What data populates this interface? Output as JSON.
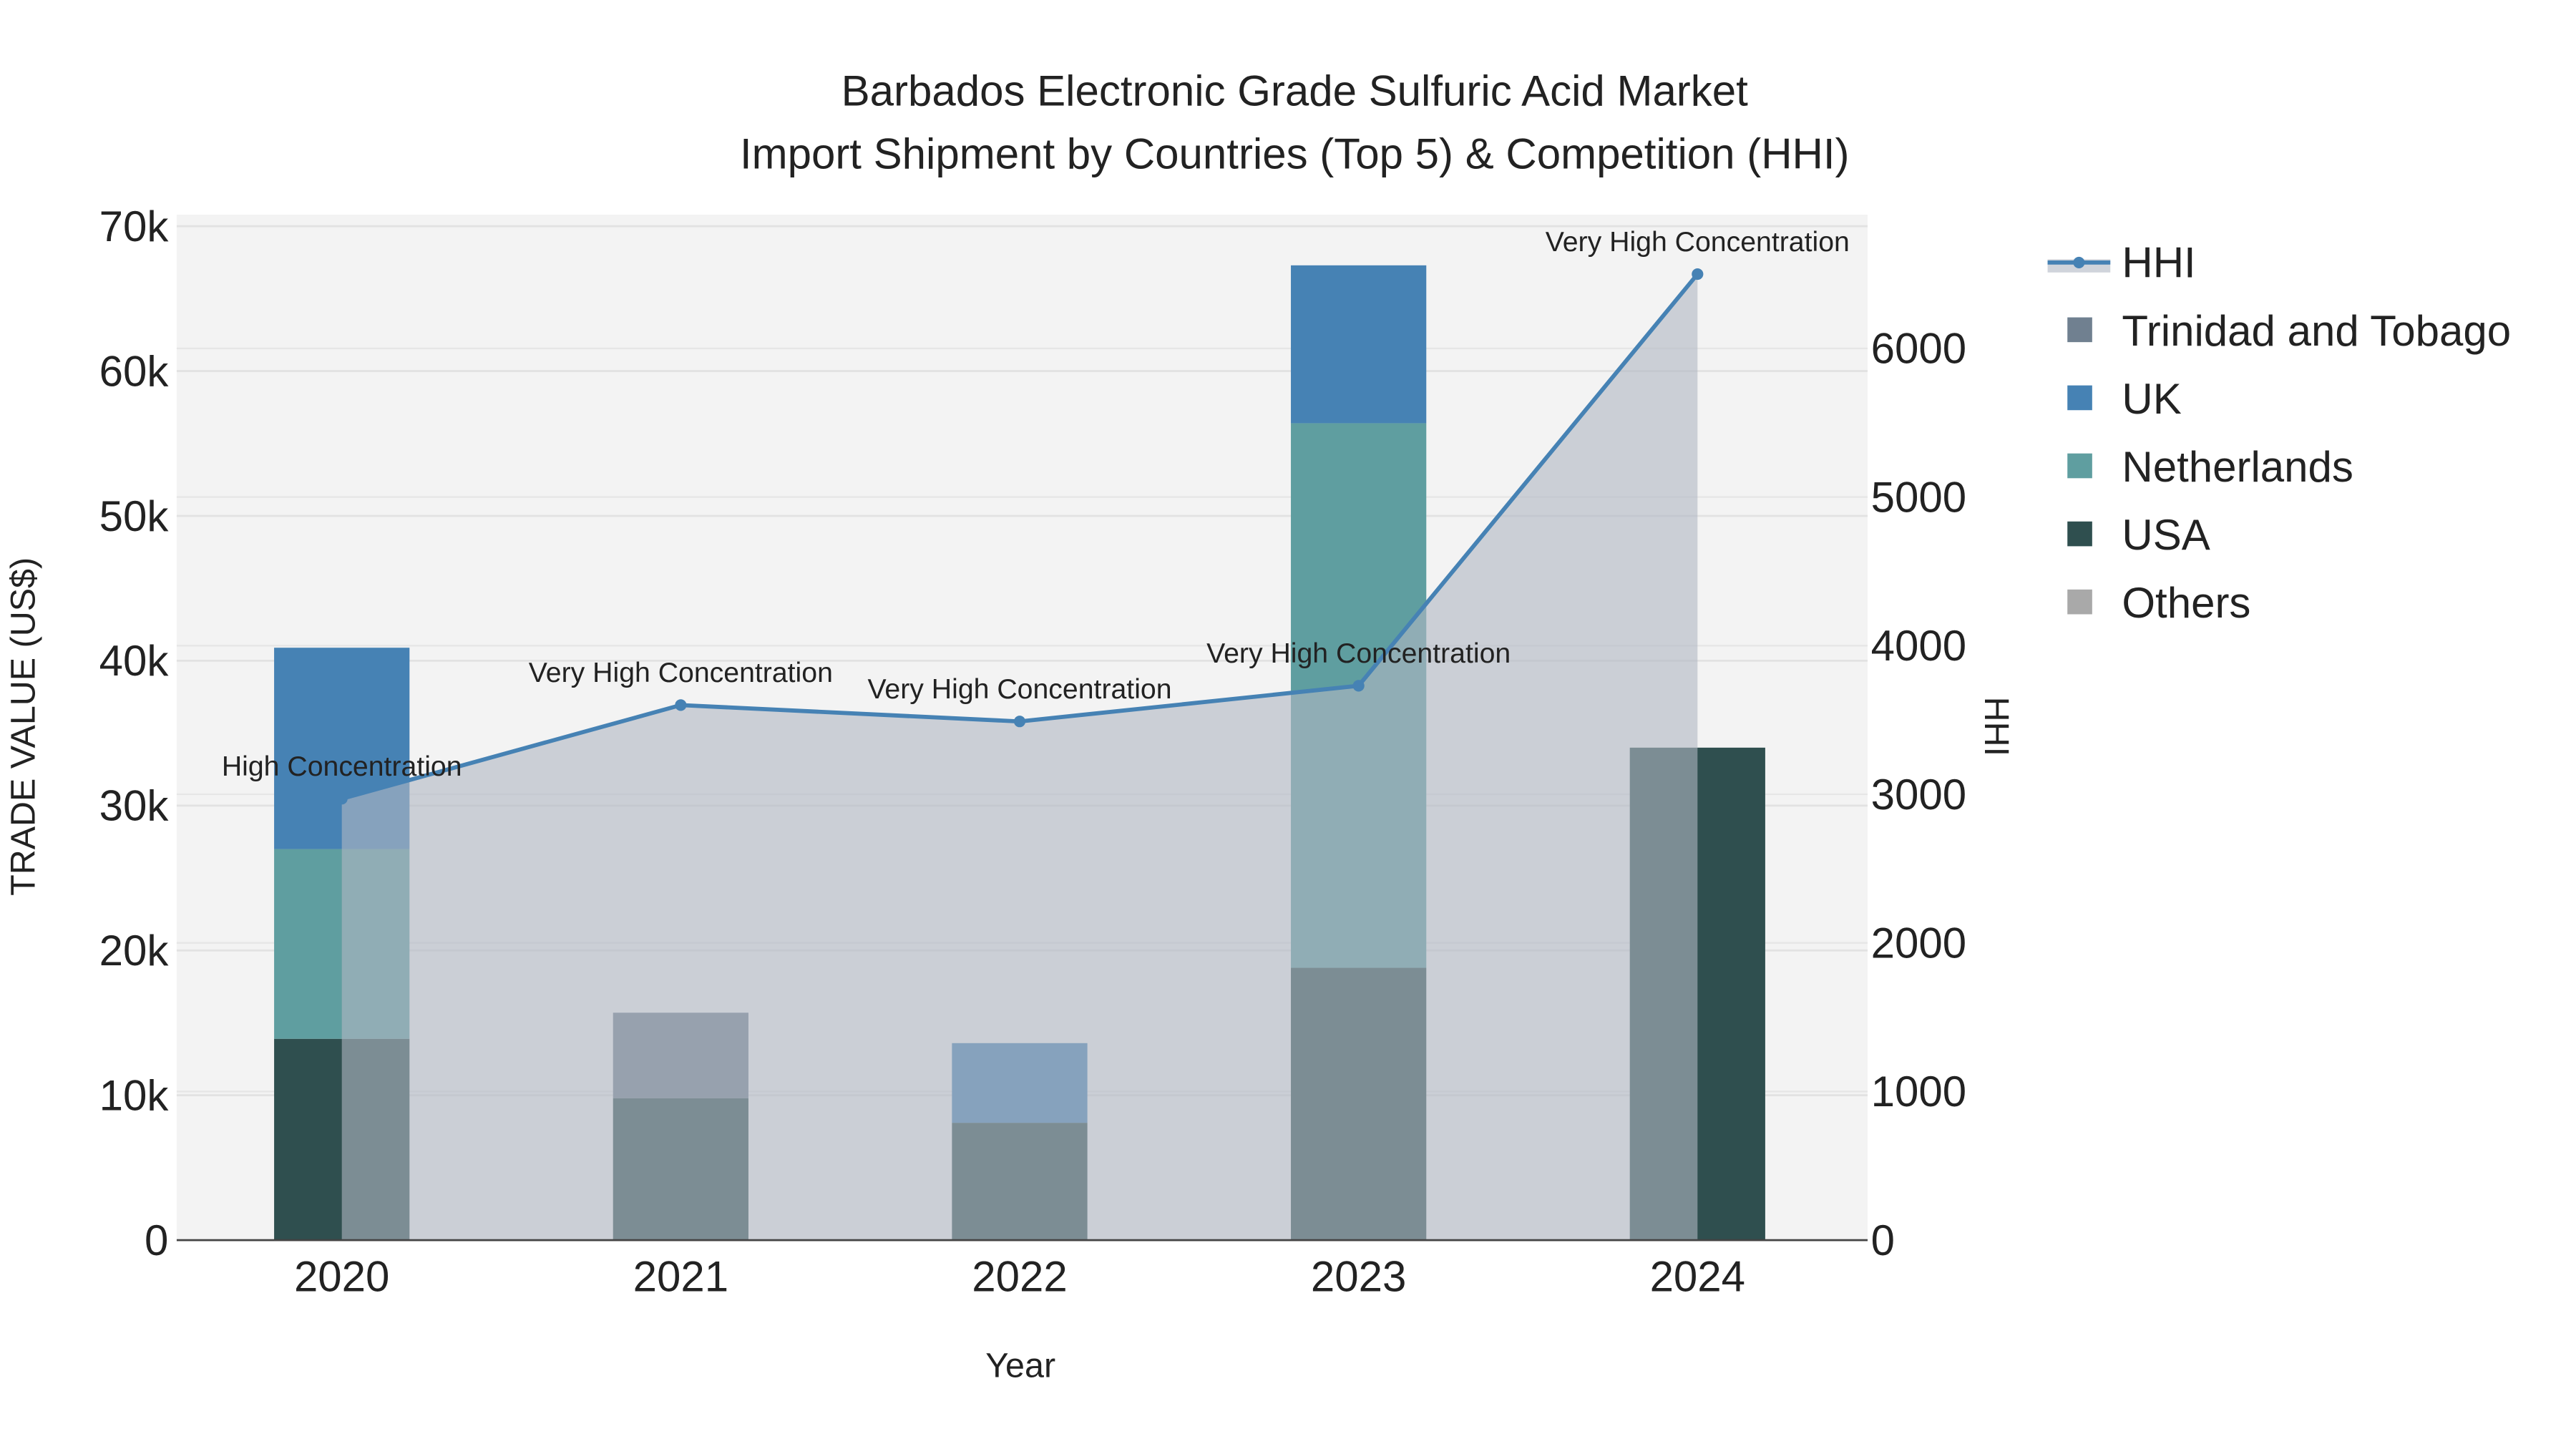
{
  "chart_data": {
    "type": "bar",
    "title": "Barbados Electronic Grade Sulfuric Acid Market",
    "subtitle": "Import Shipment by Countries (Top 5) & Competition (HHI)",
    "xlabel": "Year",
    "ylabel": "TRADE VALUE (US$)",
    "y2label": "HHI",
    "categories": [
      "2020",
      "2021",
      "2022",
      "2023",
      "2024"
    ],
    "ylim": [
      0,
      70000
    ],
    "y2lim": [
      0,
      6900
    ],
    "yticks": [
      0,
      10000,
      20000,
      30000,
      40000,
      50000,
      60000,
      70000
    ],
    "ytick_labels": [
      "0",
      "10k",
      "20k",
      "30k",
      "40k",
      "50k",
      "60k",
      "70k"
    ],
    "y2ticks": [
      0,
      1000,
      2000,
      3000,
      4000,
      5000,
      6000
    ],
    "y2tick_labels": [
      "0",
      "1000",
      "2000",
      "3000",
      "4000",
      "5000",
      "6000"
    ],
    "series": [
      {
        "name": "USA",
        "color": "#2f4f4f",
        "values": [
          13900,
          9800,
          8100,
          18800,
          34000
        ]
      },
      {
        "name": "Netherlands",
        "color": "#5f9ea0",
        "values": [
          13100,
          0,
          0,
          37600,
          0
        ]
      },
      {
        "name": "UK",
        "color": "#4682b4",
        "values": [
          13900,
          0,
          5500,
          10900,
          0
        ]
      },
      {
        "name": "Trinidad and Tobago",
        "color": "#708090",
        "values": [
          0,
          5900,
          0,
          0,
          0
        ]
      },
      {
        "name": "Others",
        "color": "#a9a9a9",
        "values": [
          0,
          0,
          0,
          0,
          0
        ]
      }
    ],
    "hhi": {
      "name": "HHI",
      "color": "#4682b4",
      "values": [
        2970,
        3600,
        3490,
        3730,
        6500
      ],
      "annotations": [
        "High Concentration",
        "Very High Concentration",
        "Very High Concentration",
        "Very High Concentration",
        "Very High Concentration"
      ]
    },
    "legend": {
      "placement": "right",
      "entries": [
        "HHI",
        "Trinidad and Tobago",
        "UK",
        "Netherlands",
        "USA",
        "Others"
      ]
    },
    "grid": true
  }
}
